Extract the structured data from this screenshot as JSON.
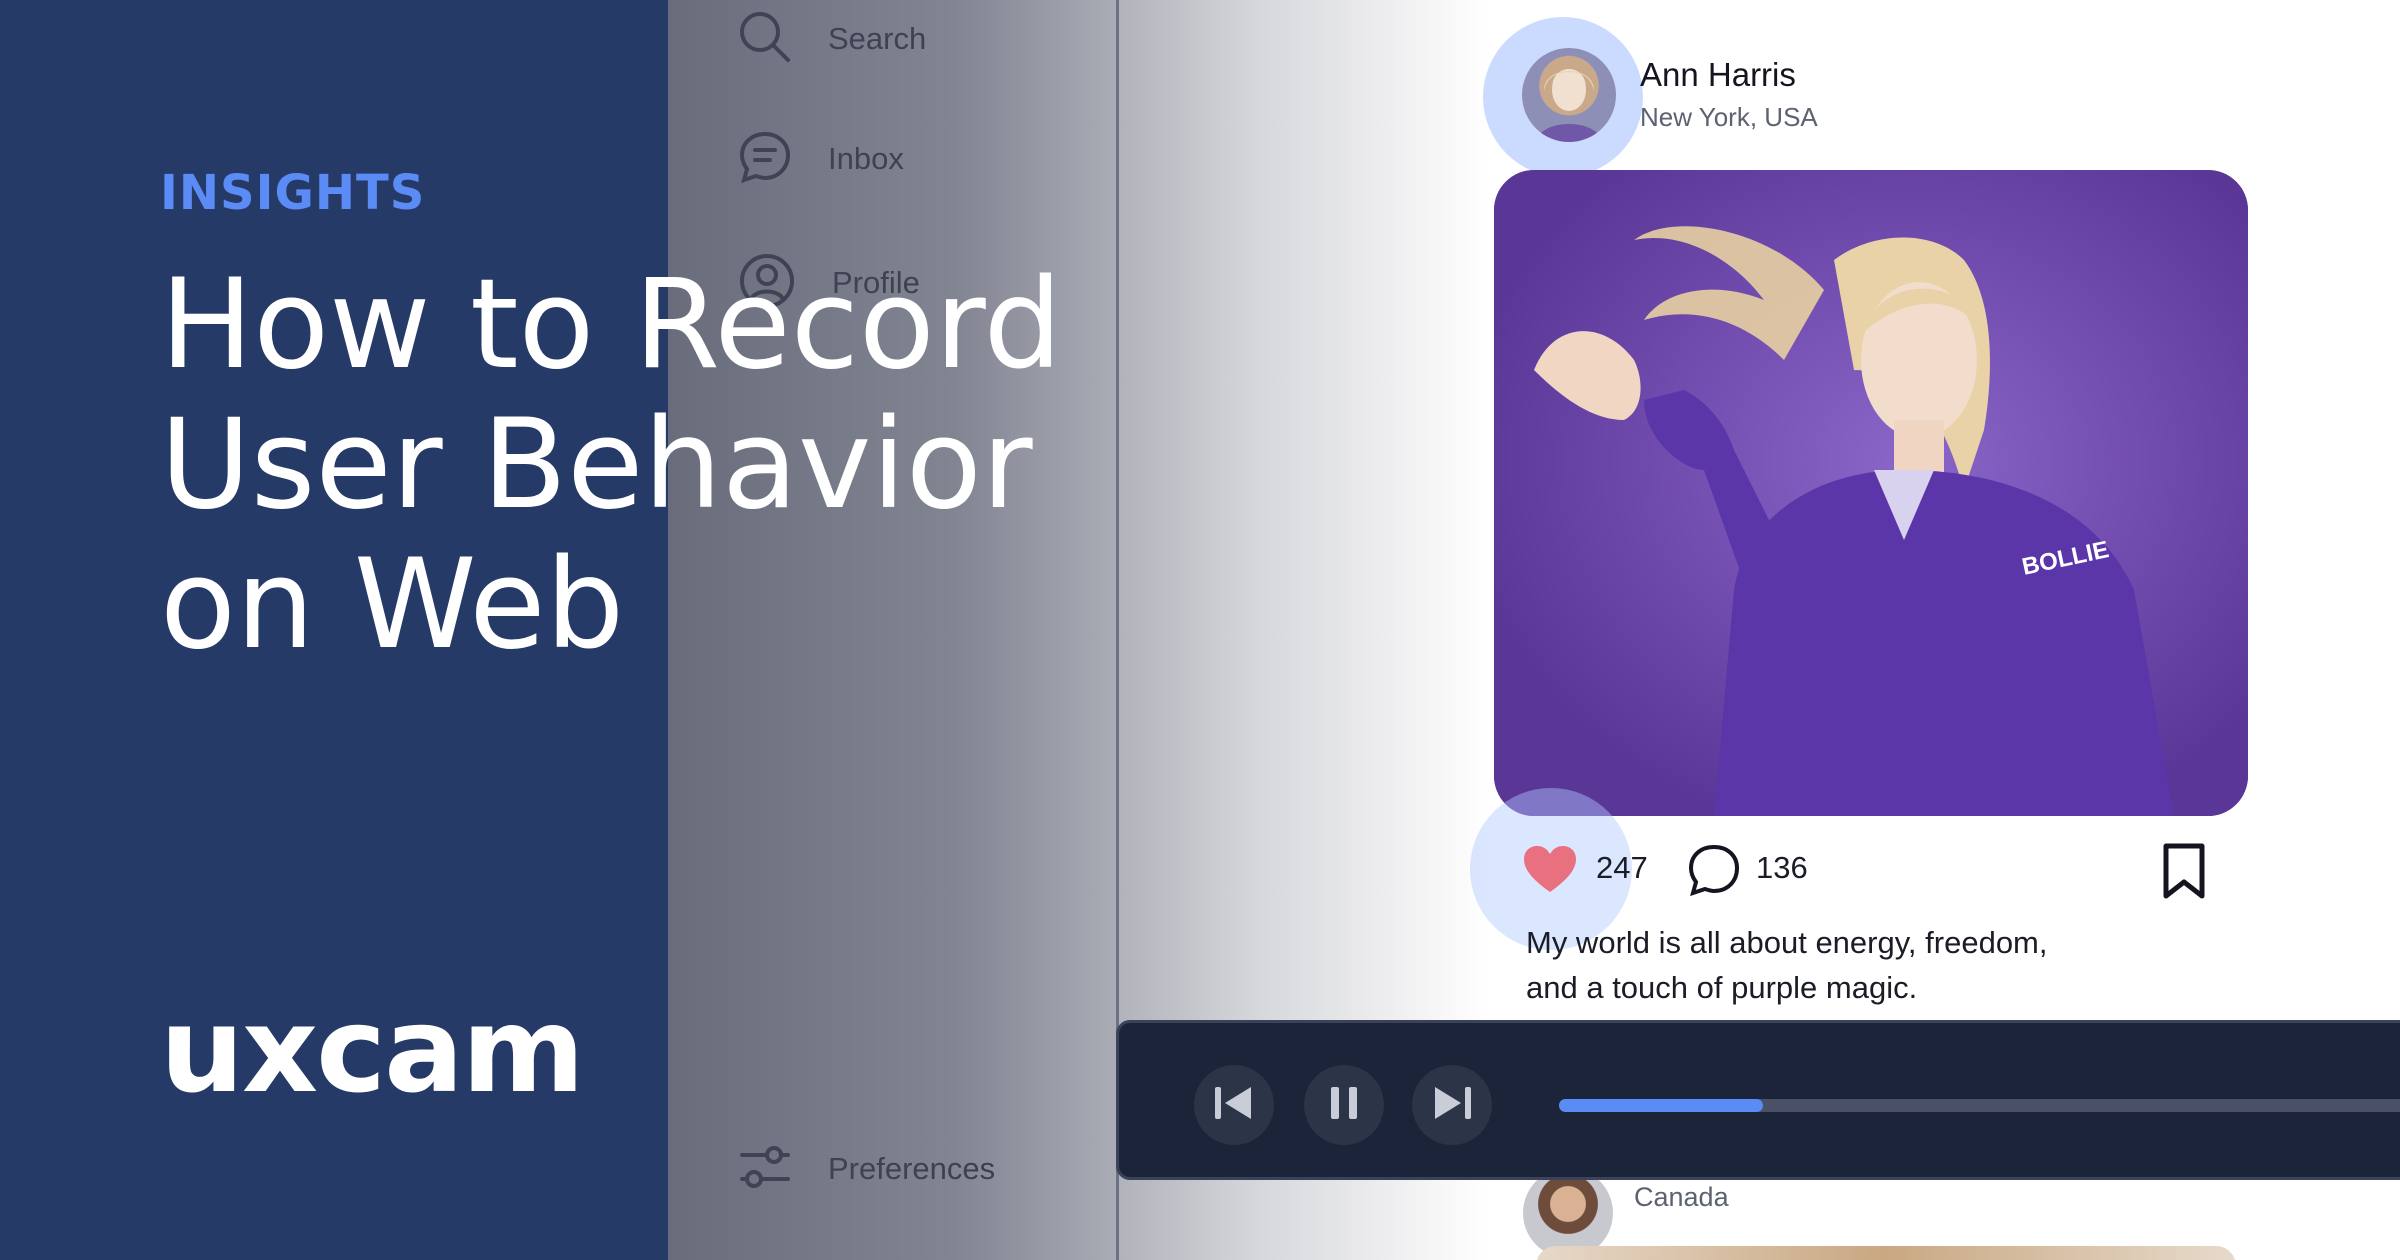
{
  "banner": {
    "kicker": "INSIGHTS",
    "headline_lines": [
      "How to Record",
      "User Behavior",
      "on Web"
    ],
    "logo_text": "uxcam",
    "colors": {
      "panel": "#263a68",
      "accent": "#5b8cf5",
      "headline": "#ffffff"
    }
  },
  "sidebar": {
    "items": [
      {
        "label": "Search",
        "icon": "search-icon"
      },
      {
        "label": "Inbox",
        "icon": "chat-bubble-icon"
      },
      {
        "label": "Profile",
        "icon": "user-circle-icon"
      },
      {
        "label": "Preferences",
        "icon": "sliders-icon"
      }
    ]
  },
  "post": {
    "author": "Ann Harris",
    "location": "New York, USA",
    "likes": "247",
    "comments": "136",
    "caption_lines": [
      "My world is all about energy, freedom,",
      "and a touch of purple magic."
    ],
    "icons": {
      "like": "heart-icon",
      "comment": "comment-icon",
      "save": "bookmark-icon"
    },
    "colors": {
      "heart": "#e8707f",
      "photo_bg": "#6a44a8"
    }
  },
  "next_post": {
    "location": "Canada"
  },
  "player": {
    "controls": [
      "skip-back-icon",
      "pause-icon",
      "skip-forward-icon"
    ],
    "progress_fraction": 0.227,
    "colors": {
      "bar": "#1c2439",
      "progress": "#5b8cf5"
    }
  }
}
